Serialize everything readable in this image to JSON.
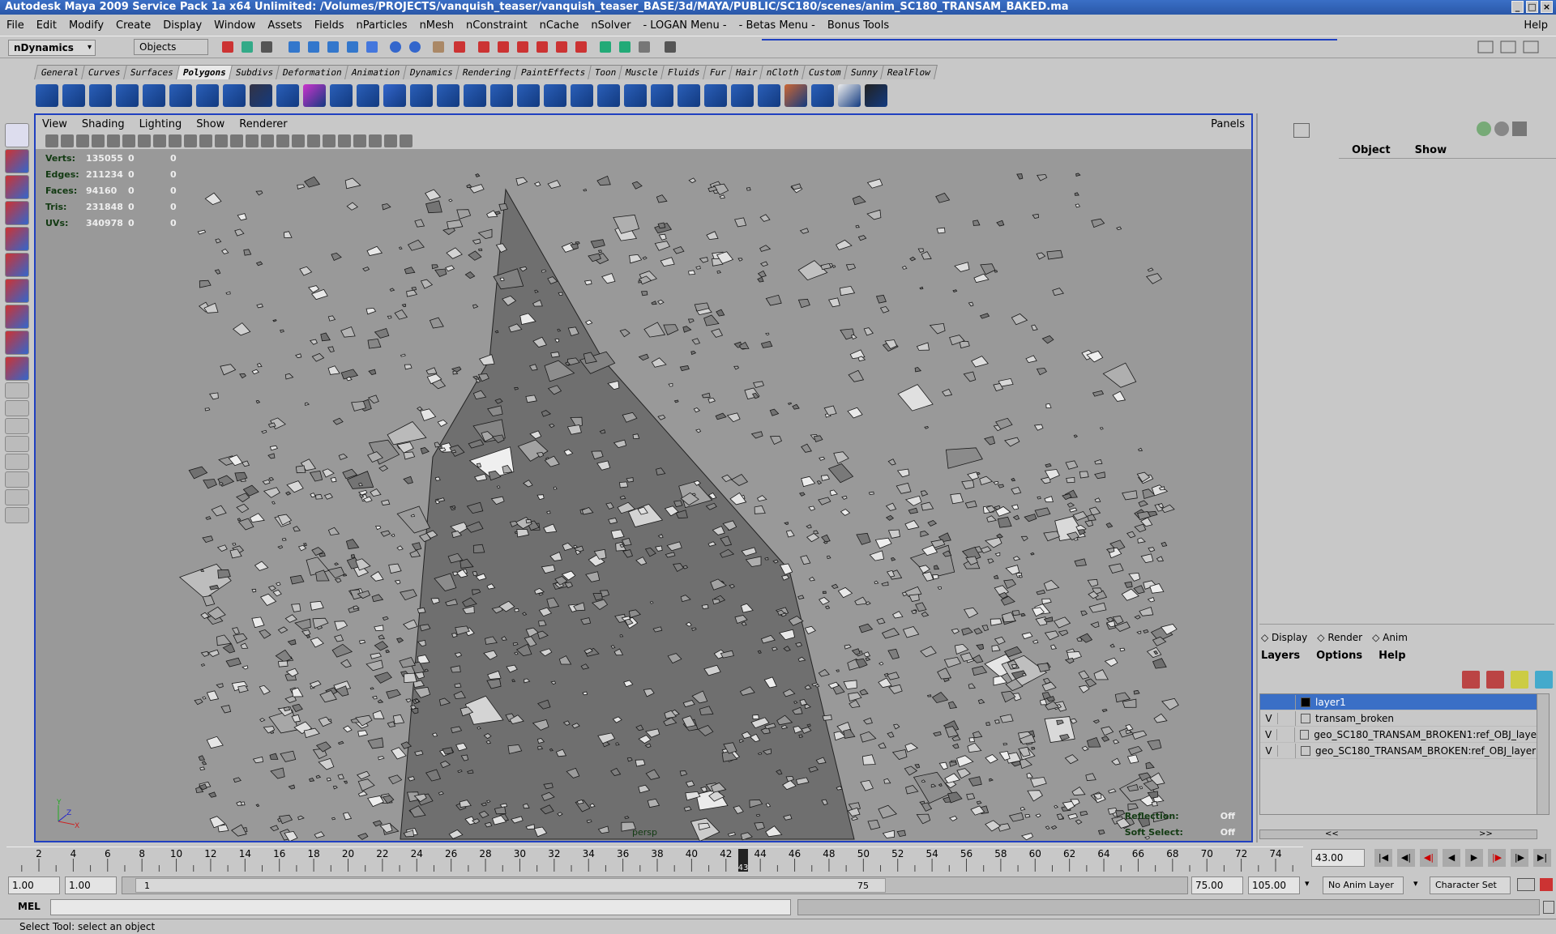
{
  "window": {
    "title": "Autodesk Maya 2009 Service Pack 1a x64 Unlimited: /Volumes/PROJECTS/vanquish_teaser/vanquish_teaser_BASE/3d/MAYA/PUBLIC/SC180/scenes/anim_SC180_TRANSAM_BAKED.ma",
    "controls": [
      "_",
      "□",
      "×"
    ]
  },
  "menubar": {
    "items": [
      "File",
      "Edit",
      "Modify",
      "Create",
      "Display",
      "Window",
      "Assets",
      "Fields",
      "nParticles",
      "nMesh",
      "nConstraint",
      "nCache",
      "nSolver",
      "- LOGAN Menu -",
      "- Betas Menu -",
      "Bonus Tools"
    ],
    "help": "Help"
  },
  "statusline": {
    "menuset": "nDynamics",
    "selection_mode": "Objects"
  },
  "shelf": {
    "tabs": [
      "General",
      "Curves",
      "Surfaces",
      "Polygons",
      "Subdivs",
      "Deformation",
      "Animation",
      "Dynamics",
      "Rendering",
      "PaintEffects",
      "Toon",
      "Muscle",
      "Fluids",
      "Fur",
      "Hair",
      "nCloth",
      "Custom",
      "Sunny",
      "RealFlow"
    ],
    "active_tab": "Polygons"
  },
  "viewport": {
    "menu": [
      "View",
      "Shading",
      "Lighting",
      "Show",
      "Renderer"
    ],
    "panels_label": "Panels",
    "camera": "persp",
    "hud": [
      {
        "label": "Verts:",
        "value": "135055",
        "sel": "0",
        "comp": "0"
      },
      {
        "label": "Edges:",
        "value": "211234",
        "sel": "0",
        "comp": "0"
      },
      {
        "label": "Faces:",
        "value": "94160",
        "sel": "0",
        "comp": "0"
      },
      {
        "label": "Tris:",
        "value": "231848",
        "sel": "0",
        "comp": "0"
      },
      {
        "label": "UVs:",
        "value": "340978",
        "sel": "0",
        "comp": "0"
      }
    ],
    "hud_right": [
      {
        "label": "Reflection:",
        "value": "Off"
      },
      {
        "label": "Soft Select:",
        "value": "Off"
      }
    ],
    "axis_labels": [
      "Y",
      "Z",
      "X"
    ]
  },
  "channel_box": {
    "tabs": [
      "Object",
      "Show"
    ]
  },
  "layer_editor": {
    "mode_tabs": [
      "Display",
      "Render",
      "Anim"
    ],
    "menu": [
      "Layers",
      "Options",
      "Help"
    ],
    "layers": [
      {
        "vis": "",
        "name": "layer1",
        "selected": true
      },
      {
        "vis": "V",
        "name": "transam_broken",
        "selected": false
      },
      {
        "vis": "V",
        "name": "geo_SC180_TRANSAM_BROKEN1:ref_OBJ_laye",
        "selected": false
      },
      {
        "vis": "V",
        "name": "geo_SC180_TRANSAM_BROKEN:ref_OBJ_layer",
        "selected": false
      }
    ],
    "scroll_left": "<<",
    "scroll_right": ">>"
  },
  "timeslider": {
    "ticks": [
      "2",
      "4",
      "6",
      "8",
      "10",
      "12",
      "14",
      "16",
      "18",
      "20",
      "22",
      "24",
      "26",
      "28",
      "30",
      "32",
      "34",
      "36",
      "38",
      "40",
      "42",
      "44",
      "46",
      "48",
      "50",
      "52",
      "54",
      "56",
      "58",
      "60",
      "62",
      "64",
      "66",
      "68",
      "70",
      "72",
      "74"
    ],
    "current_frame_marker": "43",
    "current_time": "43.00",
    "tick_min": 2,
    "tick_max": 74,
    "current_frame": 43
  },
  "range_slider": {
    "start_time": "1.00",
    "range_start": "1.00",
    "handle_start": "1",
    "handle_end": "75",
    "range_end": "75.00",
    "end_time": "105.00",
    "anim_layer": "No Anim Layer",
    "character_set": "Character Set"
  },
  "command_line": {
    "label": "MEL"
  },
  "help_line": {
    "text": "Select Tool: select an object"
  },
  "colors": {
    "selection_blue": "#3a6fc6",
    "viewport_bg": "#999999",
    "ui_gray": "#c8c8c8",
    "active_frame": "#2040c0"
  }
}
